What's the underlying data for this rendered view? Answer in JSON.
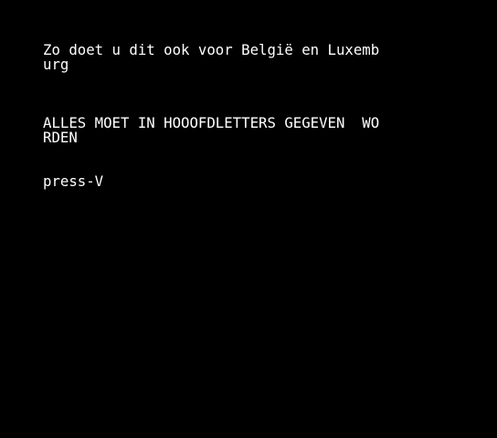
{
  "screen": {
    "lines": [
      "Zo doet u dit ook voor België en Luxemb",
      "urg",
      "ALLES MOET IN HOOOFDLETTERS GEGEVEN  WO",
      "RDEN",
      "press-V"
    ]
  },
  "colors": {
    "background": "#000000",
    "text": "#ffffff"
  }
}
